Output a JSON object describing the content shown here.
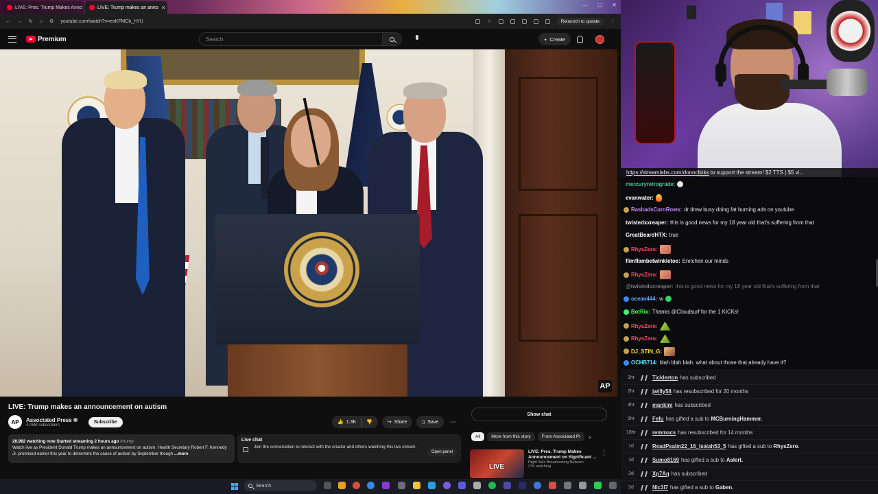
{
  "browser": {
    "tabs": [
      {
        "label": "LIVE: Pres. Trump Makes Anno"
      },
      {
        "label": "LIVE: Trump makes an anno"
      }
    ],
    "url": "youtube.com/watch?v=esKFMCb_hYU",
    "relaunch_label": "Relaunch to update"
  },
  "youtube": {
    "logo_text": "Premium",
    "search_placeholder": "Search",
    "create_label": "Create",
    "video_title": "LIVE: Trump makes an announcement on autism",
    "watermark": "AP",
    "channel": {
      "avatar": "AP",
      "name": "Associated Press",
      "subscribers": "4.05M subscribers",
      "subscribe_label": "Subscribe"
    },
    "actions": {
      "likes": "1.3K",
      "share_label": "Share",
      "save_label": "Save"
    },
    "show_chat_label": "Show chat",
    "description": {
      "stats": "28,982 watching now  Started streaming 2 hours ago",
      "hashtag": "#trump",
      "text": "Watch live as President Donald Trump makes an announcement on autism. Health Secretary Robert F. Kennedy Jr. promised earlier this year to determine the cause of autism by September though",
      "more_label": "...more"
    },
    "live_chat": {
      "title": "Live chat",
      "text": "Join the conversation to interact with the creator and others watching this live stream.",
      "open_panel_label": "Open panel"
    },
    "chips": [
      "All",
      "More from this story",
      "From Associated Pr"
    ],
    "recommendation": {
      "thumb_label": "LIVE",
      "title": "LIVE: Pres. Trump Makes Announcement on Significant ...",
      "channel": "Right Side Broadcasting Network",
      "watching": "37K watching"
    }
  },
  "stream": {
    "ticker": {
      "link": "https://streamlabs.com/donoclinks",
      "text": " to support the stream! $2 TTS | $5 vi..."
    },
    "chat": [
      {
        "user": "mercuryretrograde:",
        "text": "",
        "color": "#4fc3a1",
        "badge": "",
        "emote": "hand",
        "faded": false
      },
      {
        "user": "evanwater:",
        "text": "",
        "color": "#ffffff",
        "badge": "",
        "emote": "fire",
        "faded": false
      },
      {
        "user": "RashadsCornRows:",
        "text": "dr drew busy doing fat burning ads on youtube",
        "color": "#c98bff",
        "badge": "#c9a14a",
        "emote": "",
        "faded": false
      },
      {
        "user": "twistedxxreaper:",
        "text": "this is good news for my 18 year old that's suffering from that",
        "color": "#ffffff",
        "badge": "",
        "emote": "",
        "faded": false
      },
      {
        "user": "GreatBeardHTX:",
        "text": "true",
        "color": "#ffffff",
        "badge": "",
        "emote": "",
        "faded": false
      },
      {
        "user": "RhysZero:",
        "text": "",
        "color": "#ff4d6d",
        "badge": "#c9a14a",
        "emote": "face",
        "faded": false
      },
      {
        "user": "flimflambetwinkletoe:",
        "text": "Enrichen our minds",
        "color": "#ffffff",
        "badge": "",
        "emote": "",
        "faded": false
      },
      {
        "user": "RhysZero:",
        "text": "",
        "color": "#ff4d6d",
        "badge": "#c9a14a",
        "emote": "face",
        "faded": false
      },
      {
        "user": "@twistedxxreaper:",
        "text": "this is good news for my 18 year old that's suffering from that",
        "color": "#7a7a7a",
        "badge": "",
        "emote": "",
        "faded": true
      },
      {
        "user": "ocean444:",
        "text": "w",
        "color": "#6aa8ff",
        "badge": "#3a8aff",
        "emote": "heart",
        "faded": false
      },
      {
        "user": "BotRix:",
        "text": "Thanks @Cloudsurf for the 1 KICKs!",
        "color": "#5cff5c",
        "badge": "#3aff6a",
        "emote": "",
        "faded": false
      },
      {
        "user": "RhysZero:",
        "text": "",
        "color": "#ff4d6d",
        "badge": "#c9a14a",
        "emote": "tri",
        "faded": false
      },
      {
        "user": "RhysZero:",
        "text": "",
        "color": "#ff4d6d",
        "badge": "#c9a14a",
        "emote": "tri",
        "faded": false
      },
      {
        "user": "DJ_STIN_G:",
        "text": "",
        "color": "#ffe14d",
        "badge": "#c9a14a",
        "emote": "dance",
        "faded": false
      },
      {
        "user": "OCHB714:",
        "text": "blah blah blah. what about those that already have it?",
        "color": "#5ce8ff",
        "badge": "#3a8aff",
        "emote": "",
        "faded": false
      }
    ],
    "events": [
      {
        "time": "1hr",
        "user": "Ticklerton",
        "text": "has subscribed",
        "bold": ""
      },
      {
        "time": "2hr",
        "user": "jwilly58",
        "text": "has resubscribed for 20 months",
        "bold": ""
      },
      {
        "time": "4hr",
        "user": "mankini",
        "text": "has subscribed",
        "bold": ""
      },
      {
        "time": "5hr",
        "user": "Fefu",
        "text": "has gifted a sub to ",
        "bold": "MCBurningHammer."
      },
      {
        "time": "18hr",
        "user": "remmacs",
        "text": "has resubscribed for 14 months",
        "bold": ""
      },
      {
        "time": "1d",
        "user": "ReadPsalm22_16_Isaiah53_5",
        "text": "has gifted a sub to ",
        "bold": "RhysZero."
      },
      {
        "time": "1d",
        "user": "Sumo8169",
        "text": "has gifted a sub to ",
        "bold": "Aalert."
      },
      {
        "time": "2d",
        "user": "Xp7Aq",
        "text": "has subscribed",
        "bold": ""
      },
      {
        "time": "2d",
        "user": "Nic3l7",
        "text": "has gifted a sub to ",
        "bold": "Gaben."
      }
    ]
  },
  "taskbar": {
    "search_label": "Search"
  }
}
